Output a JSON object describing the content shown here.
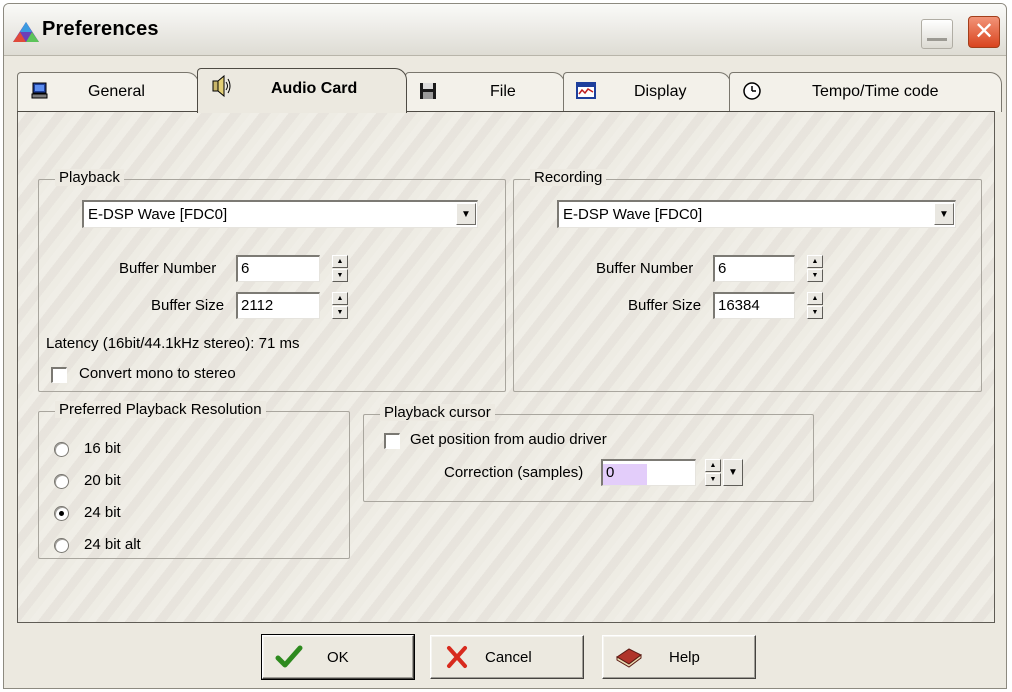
{
  "window": {
    "title": "Preferences"
  },
  "tabs": [
    {
      "label": "General",
      "icon": "computer-icon"
    },
    {
      "label": "Audio Card",
      "icon": "speaker-icon",
      "active": true
    },
    {
      "label": "File",
      "icon": "floppy-disk-icon"
    },
    {
      "label": "Display",
      "icon": "display-icon"
    },
    {
      "label": "Tempo/Time code",
      "icon": "clock-icon"
    }
  ],
  "playback": {
    "legend": "Playback",
    "device": "E-DSP Wave [FDC0]",
    "buffer_number_label": "Buffer Number",
    "buffer_number": "6",
    "buffer_size_label": "Buffer Size",
    "buffer_size": "2112",
    "latency": "Latency (16bit/44.1kHz stereo): 71 ms",
    "convert_mono_label": "Convert mono to stereo",
    "convert_mono_checked": false
  },
  "recording": {
    "legend": "Recording",
    "device": "E-DSP Wave [FDC0]",
    "buffer_number_label": "Buffer Number",
    "buffer_number": "6",
    "buffer_size_label": "Buffer Size",
    "buffer_size": "16384"
  },
  "resolution": {
    "legend": "Preferred Playback Resolution",
    "options": [
      {
        "label": "16 bit",
        "selected": false
      },
      {
        "label": "20 bit",
        "selected": false
      },
      {
        "label": "24 bit",
        "selected": true
      },
      {
        "label": "24 bit alt",
        "selected": false
      }
    ]
  },
  "cursor": {
    "legend": "Playback cursor",
    "get_position_label": "Get position from audio driver",
    "get_position_checked": false,
    "correction_label": "Correction (samples)",
    "correction_value": "0",
    "correction_highlight_color": "#e3cdfa"
  },
  "buttons": {
    "ok": "OK",
    "cancel": "Cancel",
    "help": "Help"
  },
  "colors": {
    "ok_check": "#2e8a1e",
    "cancel_x": "#d82a1e",
    "help_book": "#b0342a"
  }
}
